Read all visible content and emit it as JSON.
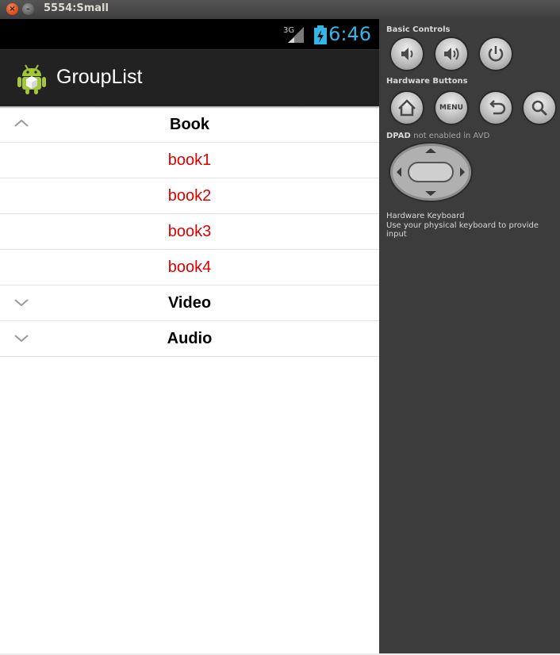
{
  "window": {
    "title": "5554:Small",
    "close_glyph": "×",
    "minimize_glyph": "–"
  },
  "status_bar": {
    "network": "3G",
    "time": "6:46",
    "icons": [
      "signal-icon",
      "battery-charging-icon"
    ]
  },
  "action_bar": {
    "title": "GroupList",
    "icon": "android-logo-icon"
  },
  "list": {
    "groups": [
      {
        "label": "Book",
        "expanded": true,
        "children": [
          "book1",
          "book2",
          "book3",
          "book4"
        ]
      },
      {
        "label": "Video",
        "expanded": false,
        "children": []
      },
      {
        "label": "Audio",
        "expanded": false,
        "children": []
      }
    ]
  },
  "panel": {
    "basic_controls_label": "Basic Controls",
    "basic_controls": [
      "volume-down-icon",
      "volume-up-icon",
      "power-icon"
    ],
    "hardware_buttons_label": "Hardware Buttons",
    "hardware_buttons": [
      "home-icon",
      "menu",
      "back-icon",
      "search-icon"
    ],
    "menu_label": "MENU",
    "dpad_label": "DPAD",
    "dpad_note": "not enabled in AVD",
    "keyboard_label": "Hardware Keyboard",
    "keyboard_note": "Use your physical keyboard to provide input"
  },
  "colors": {
    "child_text": "#e00000",
    "clock": "#33b5e5",
    "action_bar": "#222222"
  }
}
